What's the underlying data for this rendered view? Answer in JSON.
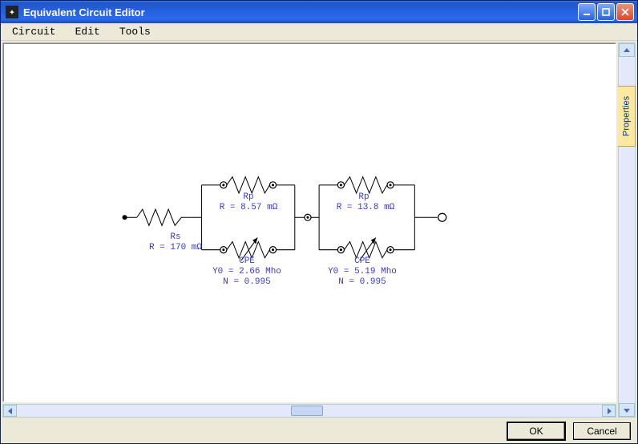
{
  "window": {
    "title": "Equivalent Circuit Editor"
  },
  "menu": {
    "items": [
      "Circuit",
      "Edit",
      "Tools"
    ]
  },
  "sidebar": {
    "properties_tab": "Properties"
  },
  "footer": {
    "ok": "OK",
    "cancel": "Cancel"
  },
  "components": {
    "rs": {
      "name": "Rs",
      "value": "R = 170 mΩ"
    },
    "rp1": {
      "name": "Rp",
      "value": "R = 8.57 mΩ"
    },
    "cpe1": {
      "name": "CPE",
      "y0": "Y0 = 2.66 Mho",
      "n": "N = 0.995"
    },
    "rp2": {
      "name": "Rp",
      "value": "R = 13.8 mΩ"
    },
    "cpe2": {
      "name": "CPE",
      "y0": "Y0 = 5.19 Mho",
      "n": "N = 0.995"
    }
  }
}
